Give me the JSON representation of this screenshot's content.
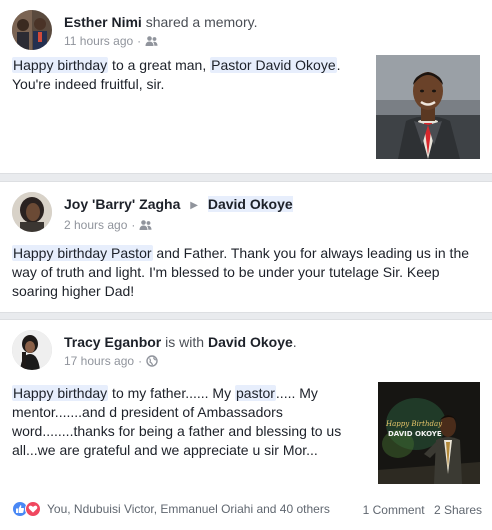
{
  "posts": [
    {
      "author": "Esther Nimi",
      "action": "shared a memory.",
      "time": "11 hours ago",
      "privacy_icon": "friends-icon",
      "text": {
        "hl1": "Happy birthday",
        "t1": " to a great man, ",
        "hl2": "Pastor David Okoye",
        "t2": ". You're indeed fruitful, sir."
      }
    },
    {
      "author": "Joy 'Barry' Zagha",
      "target": "David Okoye",
      "time": "2 hours ago",
      "privacy_icon": "friends-icon",
      "text": {
        "hl1": "Happy birthday Pastor",
        "t1": " and Father. Thank you for always leading us in the way of truth and light. I'm blessed to be under your tutelage Sir. Keep soaring higher Dad!"
      }
    },
    {
      "author": "Tracy Eganbor",
      "with_label": "is with",
      "with_name": "David Okoye",
      "with_end": ".",
      "time": "17 hours ago",
      "privacy_icon": "globe-icon",
      "text": {
        "hl1": "Happy birthday",
        "t1": " to my father...... My ",
        "hl2": "pastor",
        "t2": "..... My mentor.......and d president of Ambassadors word........thanks for being a father and blessing to us all...we are grateful and we appreciate u sir Mor..."
      },
      "photo_caption_1": "Happy Birthday",
      "photo_caption_2": "DAVID OKOYE",
      "reactions": {
        "icons": [
          "like-icon",
          "love-icon"
        ],
        "names": "You, Ndubuisi Victor, Emmanuel Oriahi and 40 others",
        "comments": "1 Comment",
        "shares": "2 Shares"
      }
    }
  ],
  "colors": {
    "highlight": "#e7eefc",
    "like": "#4a88f5",
    "love": "#f0475f",
    "muted": "#90949c"
  }
}
